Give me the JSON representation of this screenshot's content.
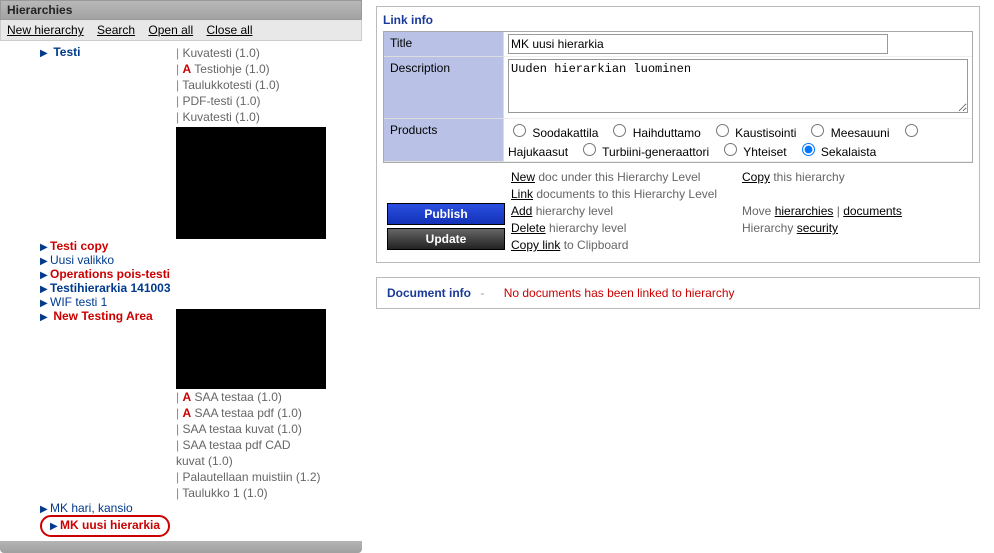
{
  "left": {
    "title": "Hierarchies",
    "toolbar": {
      "new": "New hierarchy",
      "search": "Search",
      "open": "Open all",
      "close": "Close all"
    },
    "tree": {
      "testi": "Testi",
      "testi_docs": [
        {
          "bar": "|",
          "a": "",
          "name": "Kuvatesti (1.0)"
        },
        {
          "bar": "|",
          "a": "A",
          "name": "Testiohje (1.0)"
        },
        {
          "bar": "|",
          "a": "",
          "name": "Taulukkotesti (1.0)"
        },
        {
          "bar": "|",
          "a": "",
          "name": "PDF-testi (1.0)"
        },
        {
          "bar": "|",
          "a": "",
          "name": "Kuvatesti (1.0)"
        }
      ],
      "testi_copy": "Testi copy",
      "uusi_valikko": "Uusi valikko",
      "operations": "Operations pois-testi",
      "testihier": "Testihierarkia 141003",
      "wif": "WIF testi 1",
      "new_testing": "New Testing Area",
      "saa_docs": [
        {
          "bar": "|",
          "a": "A",
          "name": "SAA testaa (1.0)"
        },
        {
          "bar": "|",
          "a": "A",
          "name": "SAA testaa pdf (1.0)"
        },
        {
          "bar": "|",
          "a": "",
          "name": "SAA testaa kuvat (1.0)"
        },
        {
          "bar": "|",
          "a": "",
          "name": "SAA testaa pdf CAD kuvat (1.0)"
        },
        {
          "bar": "|",
          "a": "",
          "name": "Palautellaan muistiin (1.2)"
        },
        {
          "bar": "|",
          "a": "",
          "name": "Taulukko 1 (1.0)"
        }
      ],
      "mk_hari": "MK hari, kansio",
      "mk_uusi": "MK uusi hierarkia"
    }
  },
  "link_info": {
    "heading": "Link info",
    "labels": {
      "title": "Title",
      "description": "Description",
      "products": "Products"
    },
    "values": {
      "title": "MK uusi hierarkia",
      "description": "Uuden hierarkian luominen"
    },
    "products": {
      "opts": [
        "Soodakattila",
        "Haihduttamo",
        "Kaustisointi",
        "Meesauuni",
        "Hajukaasut",
        "Turbiini-generaattori",
        "Yhteiset",
        "Sekalaista"
      ],
      "selected": "Sekalaista"
    },
    "buttons": {
      "publish": "Publish",
      "update": "Update"
    },
    "actions": {
      "new": "New",
      "new_tail": " doc under this Hierarchy Level",
      "link": "Link",
      "link_tail": " documents to this Hierarchy Level",
      "add": "Add",
      "add_tail": " hierarchy level",
      "delete": "Delete",
      "delete_tail": " hierarchy level",
      "copylink": "Copy link",
      "copylink_tail": " to Clipboard",
      "copy": "Copy",
      "copy_tail": " this hierarchy",
      "move": "Move ",
      "hier": "hierarchies",
      "pipe": " | ",
      "docs": "documents",
      "hsec_pre": "Hierarchy ",
      "hsec": "security"
    }
  },
  "doc_info": {
    "title": "Document info",
    "dash": "-",
    "none": "No documents has been linked to hierarchy"
  }
}
